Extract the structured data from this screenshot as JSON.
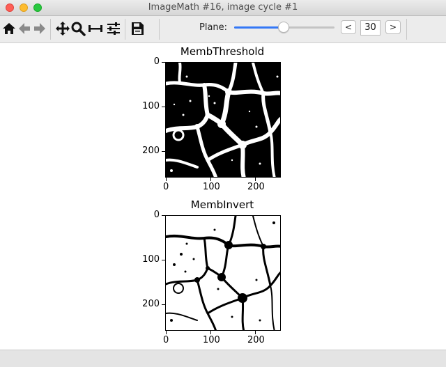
{
  "window": {
    "title": "ImageMath #16, image cycle #1"
  },
  "toolbar": {
    "icons": [
      "home-icon",
      "back-arrow-icon",
      "forward-arrow-icon",
      "pan-icon",
      "zoom-icon",
      "subplots-icon",
      "configure-icon",
      "save-icon"
    ]
  },
  "plane": {
    "label": "Plane:",
    "value": "30",
    "prev_label": "<",
    "next_label": ">",
    "slider_fraction": 0.49
  },
  "plots": [
    {
      "title": "MembThreshold",
      "xticks": [
        "0",
        "100",
        "200"
      ],
      "yticks": [
        "0",
        "100",
        "200"
      ]
    },
    {
      "title": "MembInvert",
      "xticks": [
        "0",
        "100",
        "200"
      ],
      "yticks": [
        "0",
        "100",
        "200"
      ]
    }
  ],
  "colors": {
    "accent": "#3478f6"
  }
}
